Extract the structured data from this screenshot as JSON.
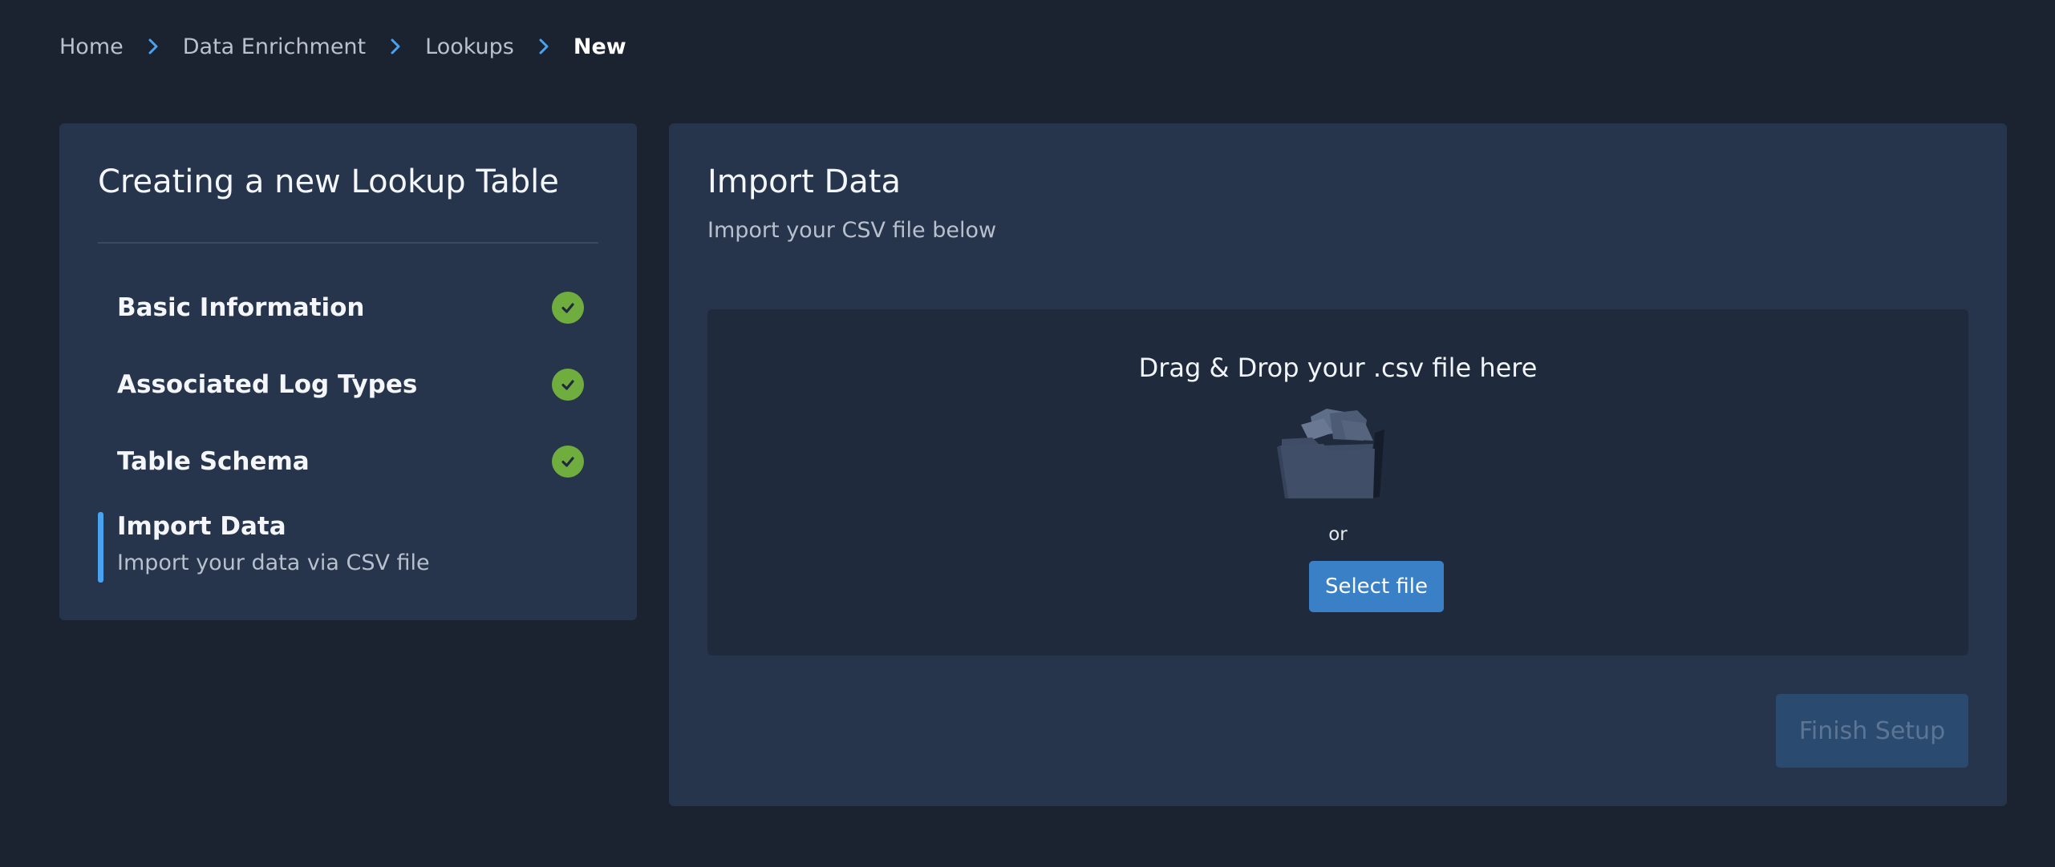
{
  "breadcrumb": {
    "items": [
      "Home",
      "Data Enrichment",
      "Lookups",
      "New"
    ],
    "separator_icon": "chevron-right-icon",
    "separator_color": "#4aa3f0"
  },
  "steps_panel": {
    "title": "Creating a new Lookup Table",
    "completed_steps": [
      {
        "label": "Basic Information",
        "status": "complete"
      },
      {
        "label": "Associated Log Types",
        "status": "complete"
      },
      {
        "label": "Table Schema",
        "status": "complete"
      }
    ],
    "active_step": {
      "label": "Import Data",
      "description": "Import your data via CSV file"
    },
    "complete_color": "#6fae3e",
    "active_color": "#4aa3f0"
  },
  "main": {
    "title": "Import Data",
    "subtitle": "Import your CSV file below",
    "dropzone": {
      "title": "Drag & Drop your .csv file here",
      "icon": "folder-icon",
      "or_text": "or",
      "select_button_label": "Select file"
    },
    "finish_button_label": "Finish Setup",
    "finish_button_disabled": true
  },
  "colors": {
    "background": "#1b2230",
    "panel": "#26344c",
    "dropzone": "#1f2a3d",
    "primary_button": "#3a80c7"
  }
}
